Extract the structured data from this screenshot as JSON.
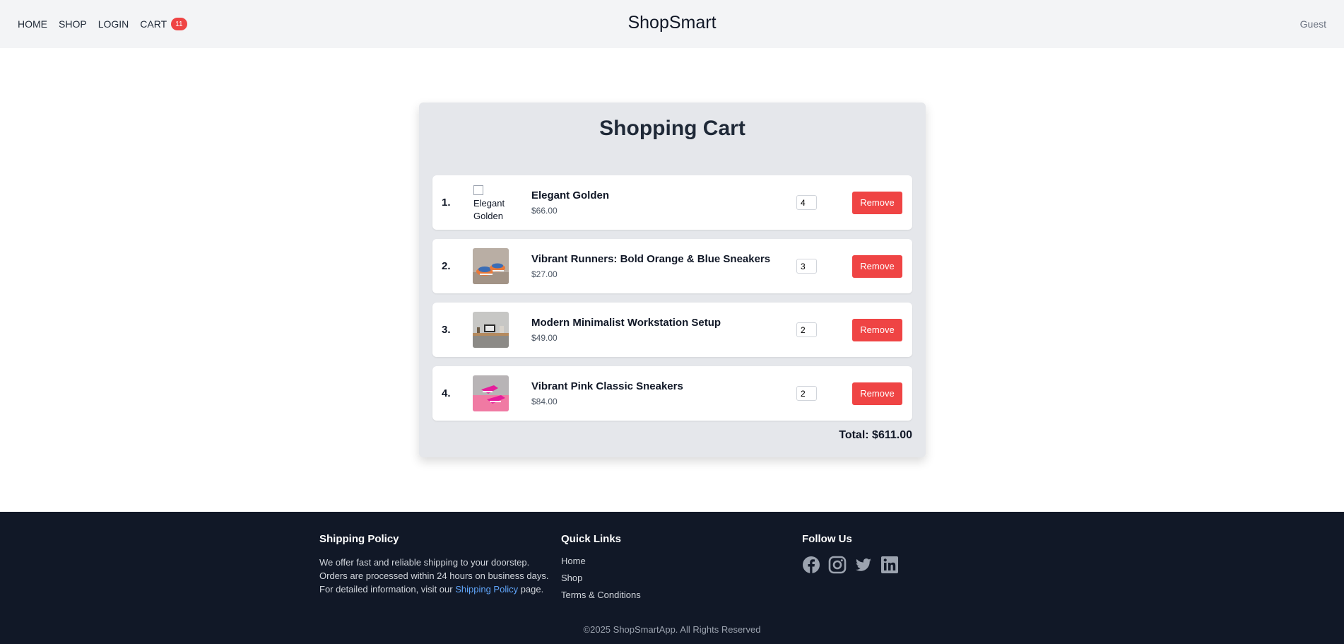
{
  "header": {
    "nav": [
      "HOME",
      "SHOP",
      "LOGIN",
      "CART"
    ],
    "cart_count": "11",
    "brand": "ShopSmart",
    "user": "Guest"
  },
  "cart": {
    "title": "Shopping Cart",
    "remove_label": "Remove",
    "total": "Total: $611.00",
    "items": [
      {
        "index": "1.",
        "name": "Elegant Golden",
        "price": "$66.00",
        "qty": "4",
        "image_alt": "Elegant Golden"
      },
      {
        "index": "2.",
        "name": "Vibrant Runners: Bold Orange & Blue Sneakers",
        "price": "$27.00",
        "qty": "3",
        "image": "sneakers-orange-blue"
      },
      {
        "index": "3.",
        "name": "Modern Minimalist Workstation Setup",
        "price": "$49.00",
        "qty": "2",
        "image": "workstation-desk"
      },
      {
        "index": "4.",
        "name": "Vibrant Pink Classic Sneakers",
        "price": "$84.00",
        "qty": "2",
        "image": "pink-sneakers"
      }
    ]
  },
  "footer": {
    "shipping": {
      "title": "Shipping Policy",
      "line1": "We offer fast and reliable shipping to your doorstep.",
      "line2": "Orders are processed within 24 hours on business days.",
      "line3_pre": "For detailed information, visit our ",
      "line3_link": "Shipping Policy",
      "line3_post": " page."
    },
    "quick_links": {
      "title": "Quick Links",
      "links": [
        "Home",
        "Shop",
        "Terms & Conditions"
      ]
    },
    "follow": {
      "title": "Follow Us",
      "icons": [
        "facebook-icon",
        "instagram-icon",
        "twitter-icon",
        "linkedin-icon"
      ]
    },
    "copyright": "©2025 ShopSmartApp. All Rights Reserved"
  },
  "colors": {
    "accent_red": "#ef4444",
    "footer_bg": "#111827",
    "link_blue": "#60a5fa"
  }
}
